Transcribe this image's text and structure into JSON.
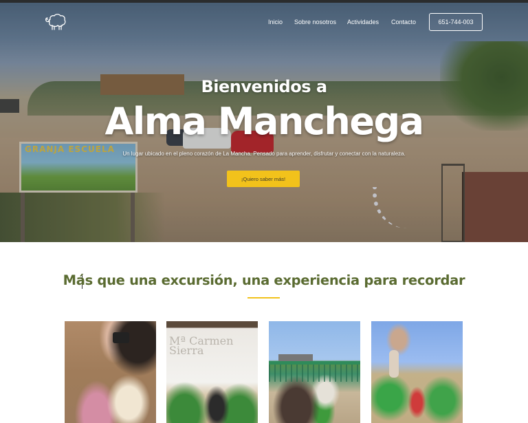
{
  "nav": {
    "logo_icon": "sheep-icon",
    "links": [
      "Inicio",
      "Sobre nosotros",
      "Actividades",
      "Contacto"
    ],
    "phone": "651-744-003"
  },
  "hero": {
    "subtitle": "Bienvenidos a",
    "title": "Alma Manchega",
    "description": "Un lugar ubicado en el pleno corazón de La Mancha. Pensado para aprender, disfrutar y conectar con la naturaleza.",
    "cta_label": "¡Quiero saber más!",
    "sign_text": "GRANJA ESCUELA"
  },
  "section": {
    "title": "Más que una excursión, una experiencia para recordar"
  },
  "cards": [
    {
      "image": "photo-girl-with-children"
    },
    {
      "image": "photo-chicks-barn",
      "wall_text": "Mª Carmen Sierra"
    },
    {
      "image": "photo-donkey-children"
    },
    {
      "image": "photo-group-in-field"
    }
  ],
  "colors": {
    "accent_yellow": "#f2c21b",
    "heading_green": "#5a6b31",
    "text_white": "#ffffff"
  }
}
